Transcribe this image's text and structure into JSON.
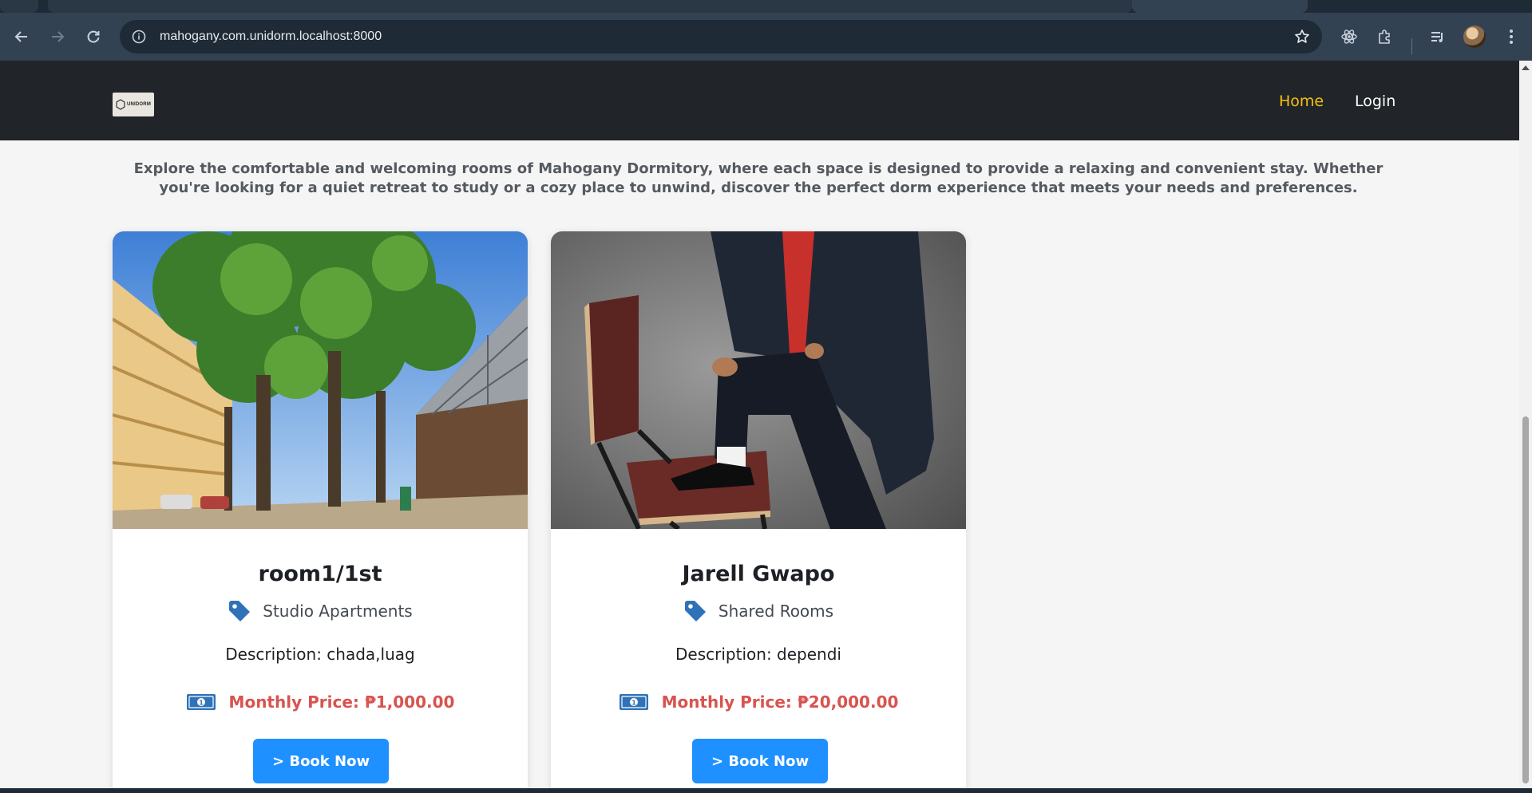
{
  "browser": {
    "url": "mahogany.com.unidorm.localhost:8000"
  },
  "site": {
    "logo_text": "UNIDORM",
    "nav": {
      "home": "Home",
      "login": "Login"
    },
    "colors": {
      "nav_bg": "#212529",
      "active_link": "#f4c20d",
      "price": "#d9534f",
      "button": "#1e90ff"
    }
  },
  "intro": {
    "text": "Explore the comfortable and welcoming rooms of Mahogany Dormitory, where each space is designed to provide a relaxing and convenient stay. Whether you're looking for a quiet retreat to study or a cozy place to unwind, discover the perfect dorm experience that meets your needs and preferences."
  },
  "rooms": [
    {
      "title": "room1/1st",
      "type": "Studio Apartments",
      "description": "Description: chada,luag",
      "price": "Monthly Price: ₱1,000.00",
      "button": "> Book Now"
    },
    {
      "title": "Jarell Gwapo",
      "type": "Shared Rooms",
      "description": "Description: dependi",
      "price": "Monthly Price: ₱20,000.00",
      "button": "> Book Now"
    }
  ]
}
